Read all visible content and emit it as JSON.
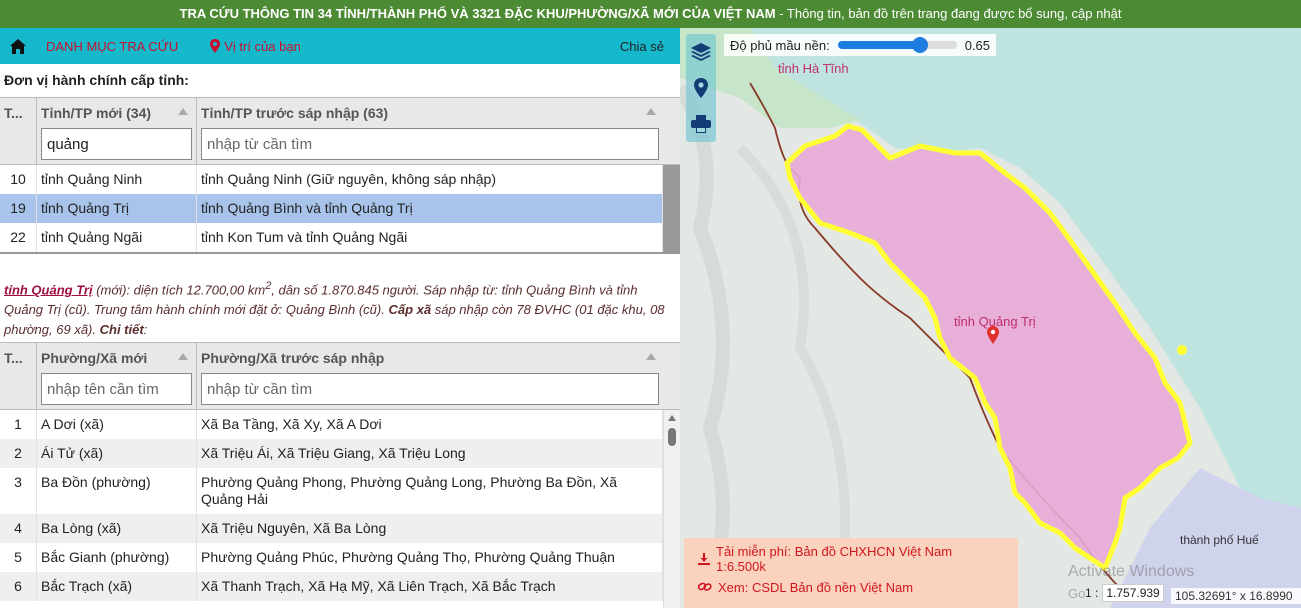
{
  "topbar": {
    "title_bold": "TRA CỨU THÔNG TIN 34 TỈNH/THÀNH PHỐ VÀ 3321 ĐẶC KHU/PHƯỜNG/XÃ MỚI CỦA VIỆT NAM",
    "title_rest": " - Thông tin, bản đồ trên trang đang được bổ sung, cập nhật"
  },
  "nav": {
    "catalog": "DANH MỤC TRA CỨU",
    "location": "Vị trí của bạn",
    "share": "Chia sẻ"
  },
  "province_section": {
    "label": "Đơn vị hành chính cấp tỉnh:",
    "headers": [
      "T...",
      "Tỉnh/TP mới (34)",
      "Tỉnh/TP trước sáp nhập (63)"
    ],
    "search_value": "quảng",
    "search_placeholder": "nhập từ cần tìm",
    "rows": [
      {
        "id": "10",
        "name": "tỉnh Quảng Ninh",
        "prev": "tỉnh Quảng Ninh (Giữ nguyên, không sáp nhập)"
      },
      {
        "id": "19",
        "name": "tỉnh Quảng Trị",
        "prev": "tỉnh Quảng Bình và tỉnh Quảng Trị"
      },
      {
        "id": "22",
        "name": "tỉnh Quảng Ngãi",
        "prev": "tỉnh Kon Tum và tỉnh Quảng Ngãi"
      }
    ]
  },
  "info": {
    "name": "tỉnh Quảng Trị",
    "t1": " (mới): diện tích 12.700,00 km",
    "sup": "2",
    "t2": ", dân số 1.870.845 người. Sáp nhập từ: tỉnh Quảng Bình và tỉnh Quảng Trị (cũ). Trung tâm hành chính mới đặt ở: Quảng Bình (cũ). ",
    "b1": "Cấp xã",
    "t3": " sáp nhập còn 78 ĐVHC (01 đặc khu, 08 phường, 69 xã). ",
    "b2": "Chi tiết",
    "t4": ":"
  },
  "ward_section": {
    "headers": [
      "T...",
      "Phường/Xã mới",
      "Phường/Xã trước sáp nhập"
    ],
    "search1_placeholder": "nhập tên cần tìm",
    "search2_placeholder": "nhập từ cần tìm",
    "rows": [
      {
        "id": "1",
        "name": "A Dơi (xã)",
        "prev": "Xã Ba Tầng, Xã Xy, Xã A Dơi"
      },
      {
        "id": "2",
        "name": "Ái Tử (xã)",
        "prev": "Xã Triệu Ái, Xã Triệu Giang, Xã Triệu Long"
      },
      {
        "id": "3",
        "name": "Ba Đồn (phường)",
        "prev": "Phường Quảng Phong, Phường Quảng Long, Phường Ba Đồn, Xã Quảng Hải"
      },
      {
        "id": "4",
        "name": "Ba Lòng (xã)",
        "prev": "Xã Triệu Nguyên, Xã Ba Lòng"
      },
      {
        "id": "5",
        "name": "Bắc Gianh (phường)",
        "prev": "Phường Quảng Phúc, Phường Quảng Thọ, Phường Quảng Thuận"
      },
      {
        "id": "6",
        "name": "Bắc Trạch (xã)",
        "prev": "Xã Thanh Trạch, Xã Hạ Mỹ, Xã Liên Trạch, Xã Bắc Trạch"
      }
    ]
  },
  "map": {
    "opacity_label": "Độ phủ mầu nền:",
    "opacity_value": "0.65",
    "opacity_fraction": 0.65,
    "label_ha_tinh": "tỉnh Hà Tĩnh",
    "label_quang_tri": "tỉnh Quảng Trị",
    "label_hue": "thành phố Huế",
    "download_text": "Tải miễn phí: Bản đồ CHXHCN Việt Nam 1:6.500k",
    "view_text": "Xem: CSDL Bản đồ nền Việt Nam",
    "watermark": "Activate Windows",
    "watermark2": "Go",
    "scale_prefix": "1 :",
    "scale_value": "1.757.939",
    "coords": "105.32691° x 16.8990",
    "colors": {
      "province_fill": "#e8a8d6",
      "province_border": "#ffff33",
      "sea": "#bfe4e0",
      "land": "#e2e8e4"
    },
    "icons": [
      "layers-icon",
      "location-pin-icon",
      "print-icon"
    ]
  }
}
